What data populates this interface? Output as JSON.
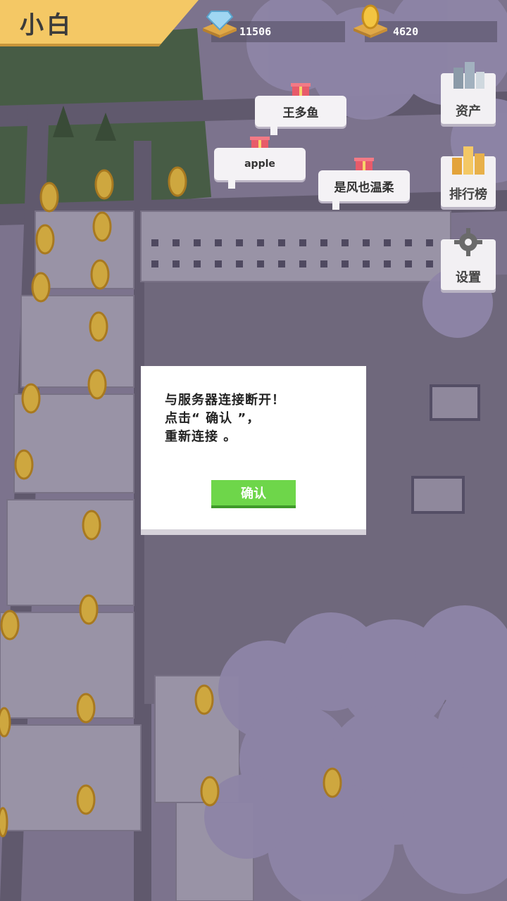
{
  "player": {
    "name": "小白"
  },
  "resources": {
    "diamonds": "11506",
    "coins": "4620"
  },
  "menu": {
    "assets": "资产",
    "leaderboard": "排行榜",
    "settings": "设置"
  },
  "bubbles": [
    {
      "name": "王多鱼"
    },
    {
      "name": "apple"
    },
    {
      "name": "是风也温柔"
    }
  ],
  "dialog": {
    "line1": "与服务器连接断开！",
    "line2": "点击“ 确认 ”，",
    "line3": "重新连接 。",
    "confirm_label": "确认"
  },
  "colors": {
    "accent_yellow": "#f4c865",
    "confirm_green": "#6ed64a",
    "fog_purple": "#8c839a"
  }
}
